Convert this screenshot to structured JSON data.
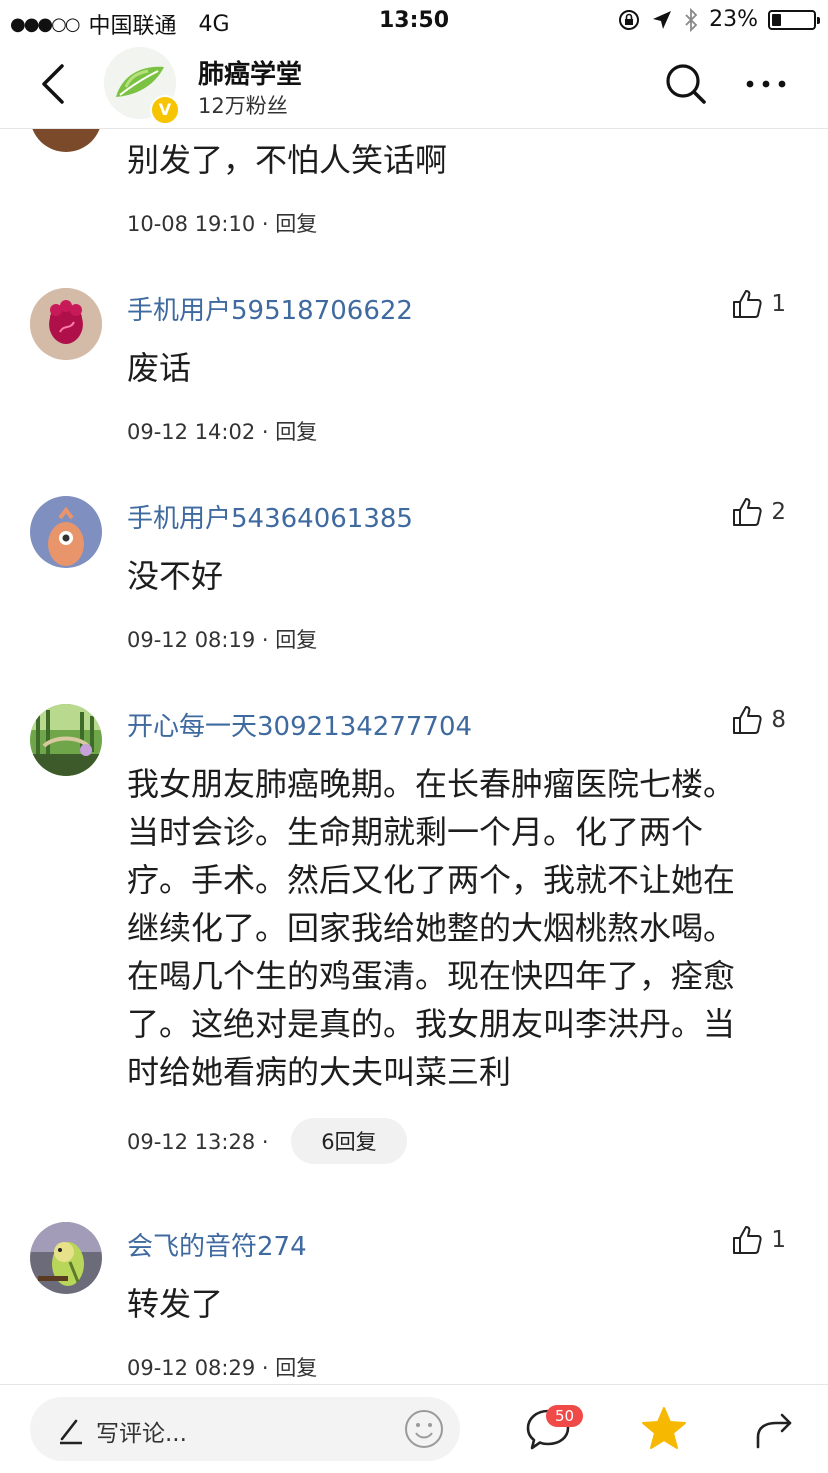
{
  "status_bar": {
    "signal": "●●●○○",
    "carrier": "中国联通",
    "network": "4G",
    "time": "13:50",
    "battery": "23%",
    "battery_level": 0.23
  },
  "header": {
    "account_name": "肺癌学堂",
    "followers": "12万粉丝",
    "verified_badge": "V"
  },
  "comments": [
    {
      "text": "别发了，不怕人笑话啊",
      "time": "10-08 19:10",
      "reply_label": "回复"
    },
    {
      "user": "手机用户59518706622",
      "text": "废话",
      "time": "09-12 14:02",
      "reply_label": "回复",
      "likes": "1"
    },
    {
      "user": "手机用户54364061385",
      "text": "没不好",
      "time": "09-12 08:19",
      "reply_label": "回复",
      "likes": "2"
    },
    {
      "user": "开心每一天3092134277704",
      "text_lines": [
        "我女朋友肺癌晚期。在长春肿瘤医院七楼。",
        "当时会诊。生命期就剩一个月。化了两个",
        "疗。手术。然后又化了两个，我就不让她在",
        "继续化了。回家我给她整的大烟桃熬水喝。",
        "在喝几个生的鸡蛋清。现在快四年了，痊愈",
        "了。这绝对是真的。我女朋友叫李洪丹。当",
        "时给她看病的大夫叫菜三利"
      ],
      "time": "09-12 13:28",
      "reply_count_label": "6回复",
      "likes": "8"
    },
    {
      "user": "会飞的音符274",
      "text": "转发了",
      "time": "09-12 08:29",
      "reply_label": "回复",
      "likes": "1"
    }
  ],
  "bottom_bar": {
    "input_placeholder": "写评论...",
    "comment_count": "50"
  },
  "colors": {
    "username": "#3f6aa0",
    "badge_red": "#f04a48",
    "star_yellow": "#f6b800",
    "verified_yellow": "#f6c400"
  }
}
